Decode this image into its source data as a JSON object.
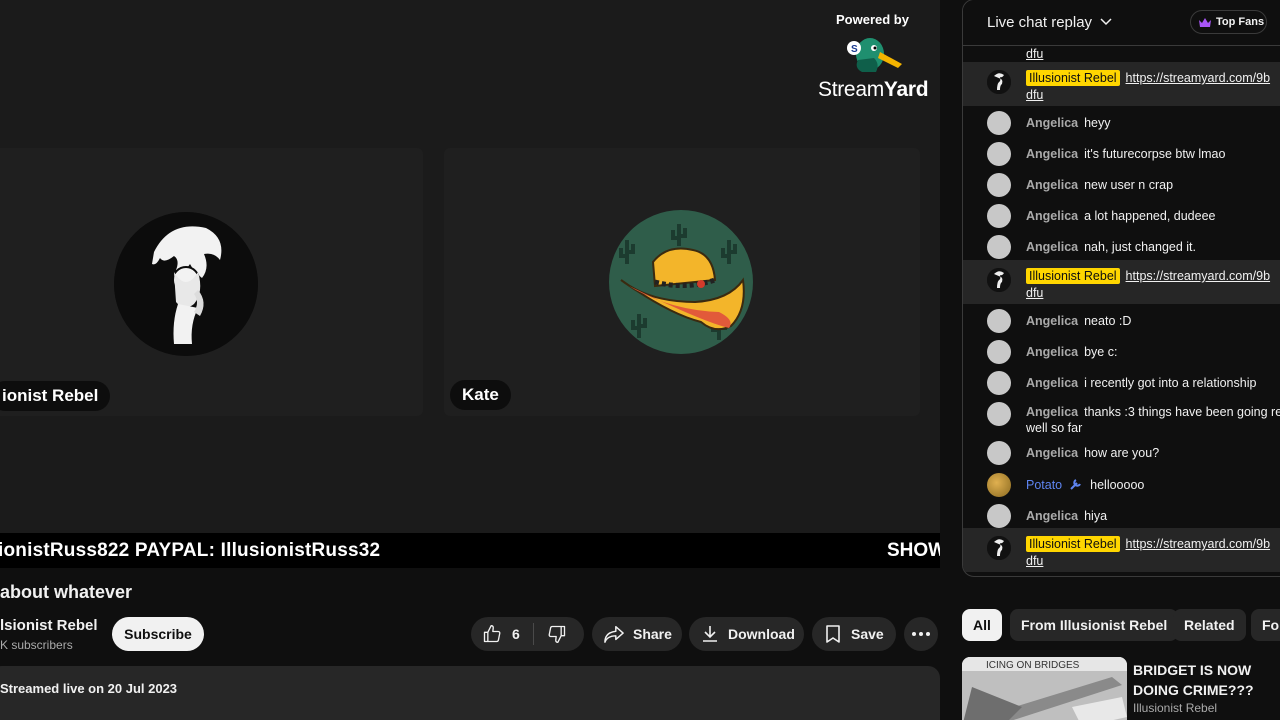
{
  "overlay": {
    "ticker_text": "ionistRuss822 PAYPAL: IllusionistRuss32",
    "ticker_right": "SHOW",
    "powered_by": "Powered by",
    "logo_text_regular": "Stream",
    "logo_text_bold": "Yard"
  },
  "participants": [
    {
      "name": "ionist Rebel"
    },
    {
      "name": "Kate"
    }
  ],
  "video": {
    "title": "about whatever",
    "channel_name": "lsionist Rebel",
    "subscribers": "K subscribers",
    "subscribe_label": "Subscribe",
    "like_count": "6",
    "share_label": "Share",
    "download_label": "Download",
    "save_label": "Save",
    "description": "Streamed live on 20 Jul 2023"
  },
  "chat": {
    "title": "Live chat replay",
    "top_fans_label": "Top Fans",
    "top_cut_text": "dfu",
    "messages": [
      {
        "author": "Illusionist Rebel",
        "text": "https://streamyard.com/9b",
        "cont": "dfu"
      },
      {
        "author": "Angelica",
        "text": "heyy"
      },
      {
        "author": "Angelica",
        "text": "it's futurecorpse btw lmao"
      },
      {
        "author": "Angelica",
        "text": "new user n crap"
      },
      {
        "author": "Angelica",
        "text": "a lot happened, dudeee"
      },
      {
        "author": "Angelica",
        "text": "nah, just changed it."
      },
      {
        "author": "Illusionist Rebel",
        "text": "https://streamyard.com/9b",
        "cont": "dfu"
      },
      {
        "author": "Angelica",
        "text": "neato :D"
      },
      {
        "author": "Angelica",
        "text": "bye c:"
      },
      {
        "author": "Angelica",
        "text": "i recently got into a relationship"
      },
      {
        "author": "Angelica",
        "text": "thanks :3 things have been going re",
        "cont": "well so far"
      },
      {
        "author": "Angelica",
        "text": "how are you?"
      },
      {
        "author": "Potato",
        "text": "hellooooo"
      },
      {
        "author": "Angelica",
        "text": "hiya"
      },
      {
        "author": "Illusionist Rebel",
        "text": "https://streamyard.com/9b",
        "cont": "dfu"
      }
    ]
  },
  "filters": [
    "All",
    "From Illusionist Rebel",
    "Related",
    "For"
  ],
  "recommendation": {
    "title": "BRIDGET IS NOW DOING CRIME???",
    "channel": "Illusionist Rebel",
    "thumb_text": "ICING ON BRIDGES"
  },
  "colors": {
    "owner_badge": "#ffd600",
    "moderator": "#5e84f1",
    "top_fans_crown": "#a855f7"
  }
}
